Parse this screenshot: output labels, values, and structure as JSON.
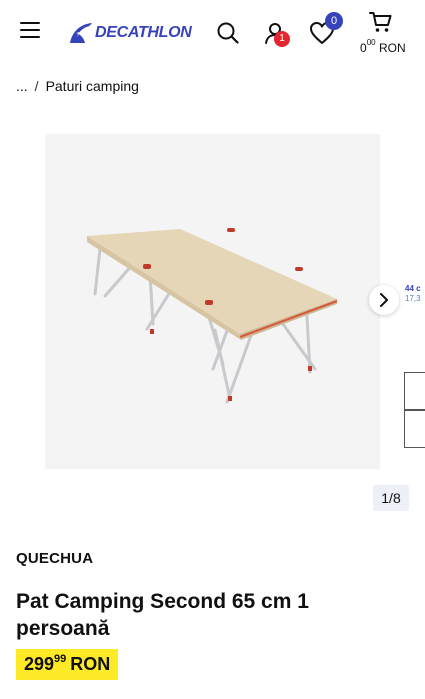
{
  "header": {
    "logo_text": "DECATHLON",
    "account_badge": "1",
    "wishlist_badge": "0",
    "cart_total_int": "0",
    "cart_total_dec": "00",
    "cart_currency": "RON",
    "icons": [
      "menu-icon",
      "search-icon",
      "account-icon",
      "heart-icon",
      "cart-icon"
    ],
    "brand_color": "#3643ba",
    "badge_red": "#e3262f"
  },
  "breadcrumb": {
    "ellipsis": "...",
    "separator": "/",
    "current": "Paturi camping"
  },
  "gallery": {
    "counter": "1/8",
    "side_peek_line1": "44 c",
    "side_peek_line2": "17,3"
  },
  "product": {
    "brand": "QUECHUA",
    "title": "Pat Camping Second 65 cm 1 persoană",
    "price_int": "299",
    "price_dec": "99",
    "price_currency": "RON",
    "price_bg": "#ffea28"
  }
}
